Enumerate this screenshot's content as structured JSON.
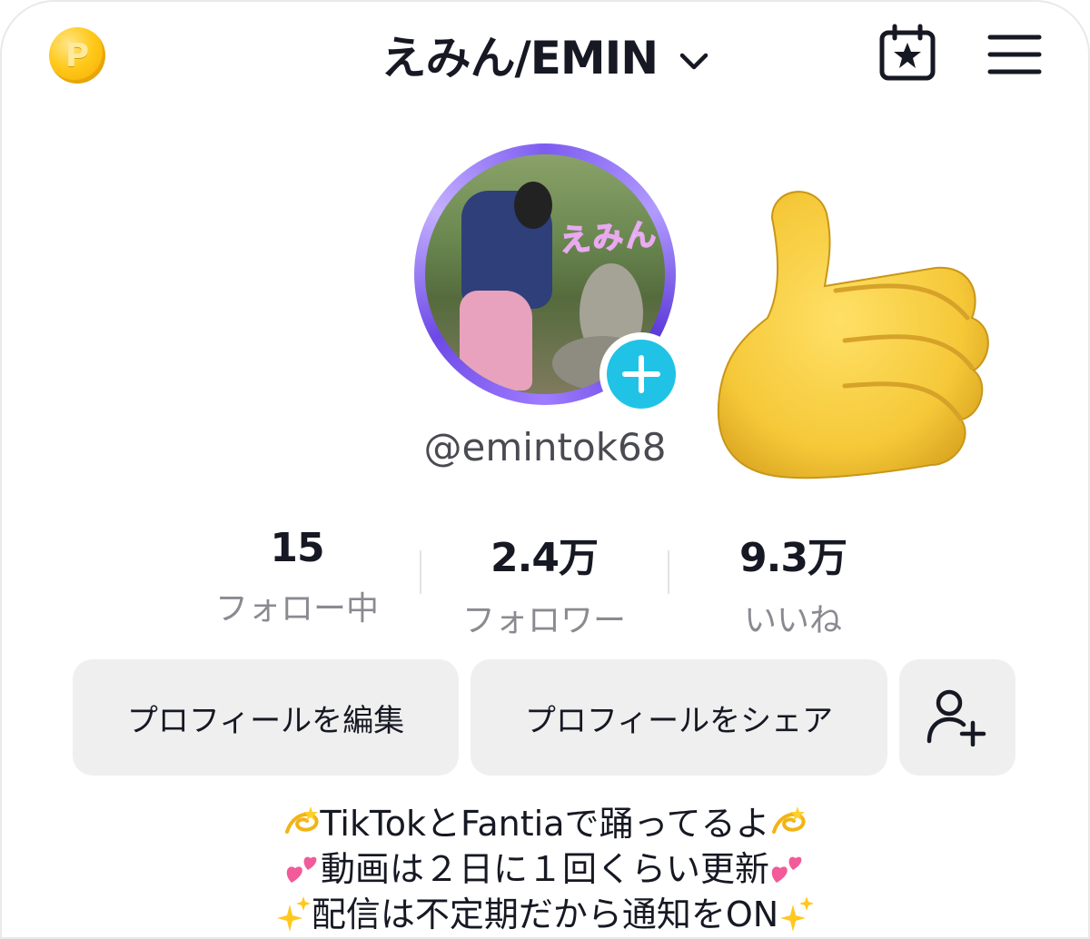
{
  "header": {
    "coin_letter": "P",
    "title": "えみん/EMIN",
    "icons": {
      "coin": "coin-icon",
      "dropdown": "chevron-down-icon",
      "calendar": "calendar-star-icon",
      "menu": "hamburger-menu-icon"
    }
  },
  "profile": {
    "username": "@emintok68",
    "avatar_overlay_text": "えみん",
    "add_badge_icon": "plus-icon",
    "sticker": "thumbs-up-sticker"
  },
  "stats": [
    {
      "value": "15",
      "label": "フォロー中"
    },
    {
      "value": "2.4万",
      "label": "フォロワー"
    },
    {
      "value": "9.3万",
      "label": "いいね"
    }
  ],
  "actions": {
    "edit_label": "プロフィールを編集",
    "share_label": "プロフィールをシェア",
    "add_friend_icon": "add-user-icon"
  },
  "bio": {
    "line1": "TikTokとFantiaで踊ってるよ",
    "line2": "動画は２日に１回くらい更新",
    "line3": "配信は不定期だから通知をON"
  },
  "colors": {
    "accent_cyan": "#20c3e6",
    "button_bg": "#efefef",
    "text_primary": "#161823",
    "text_secondary": "#8a8b91"
  }
}
